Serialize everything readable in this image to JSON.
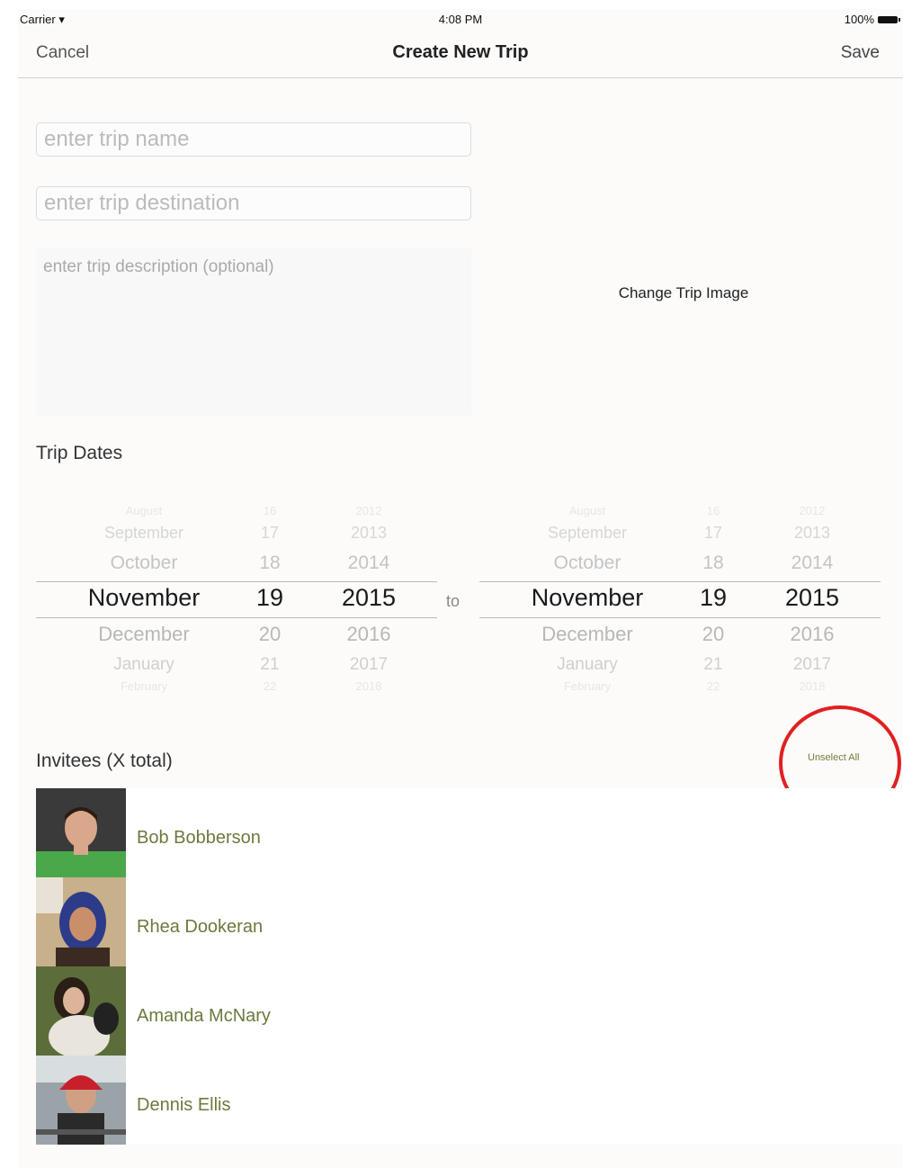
{
  "status_bar": {
    "carrier": "Carrier",
    "time": "4:08 PM",
    "battery": "100%"
  },
  "nav": {
    "cancel": "Cancel",
    "title": "Create New Trip",
    "save": "Save"
  },
  "form": {
    "trip_name_placeholder": "enter trip name",
    "trip_destination_placeholder": "enter trip destination",
    "trip_description_placeholder": "enter trip description (optional)",
    "change_image": "Change Trip Image"
  },
  "dates": {
    "label": "Trip Dates",
    "separator": "to",
    "months": [
      "August",
      "September",
      "October",
      "November",
      "December",
      "January",
      "February"
    ],
    "days": [
      "16",
      "17",
      "18",
      "19",
      "20",
      "21",
      "22"
    ],
    "years": [
      "2012",
      "2013",
      "2014",
      "2015",
      "2016",
      "2017",
      "2018"
    ],
    "start": {
      "month": "November",
      "day": "19",
      "year": "2015"
    },
    "end": {
      "month": "November",
      "day": "19",
      "year": "2015"
    }
  },
  "invitees": {
    "label": "Invitees (X total)",
    "unselect_all": "Unselect All",
    "annotation_color": "#e02020",
    "people": [
      {
        "name": "Bob Bobberson",
        "icon": "person-photo"
      },
      {
        "name": "Rhea Dookeran",
        "icon": "person-photo"
      },
      {
        "name": "Amanda McNary",
        "icon": "person-photo"
      },
      {
        "name": "Dennis Ellis",
        "icon": "person-photo"
      }
    ]
  }
}
